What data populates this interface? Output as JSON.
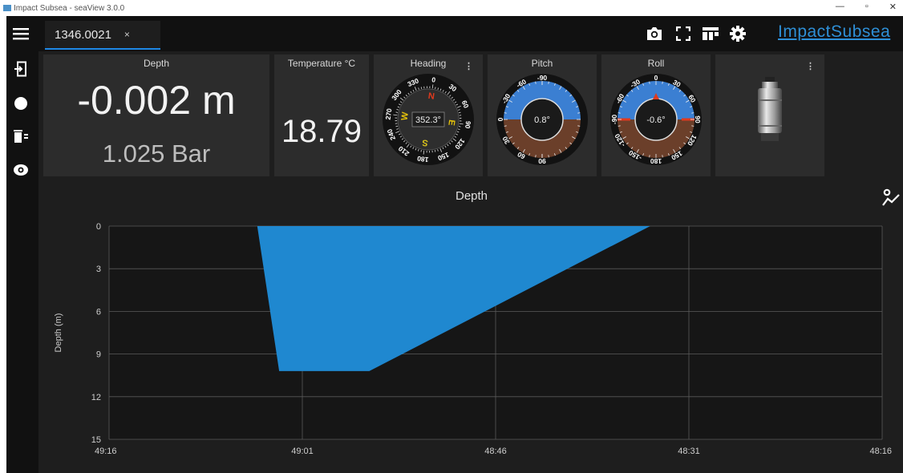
{
  "window": {
    "title": "Impact Subsea - seaView 3.0.0",
    "controls": [
      "—",
      "▫",
      "✕"
    ]
  },
  "sidebar": {
    "icons": [
      "hamburger-menu-icon",
      "connect-device-icon",
      "record-icon",
      "delete-icon",
      "view-icon"
    ]
  },
  "tab": {
    "label": "1346.0021",
    "close": "×"
  },
  "toolbar": {
    "icons": [
      "camera-icon",
      "fullscreen-icon",
      "layout-icon",
      "settings-icon"
    ],
    "brand": "ImpactSubsea"
  },
  "cards": {
    "depth": {
      "title": "Depth",
      "value": "-0.002 m",
      "pressure": "1.025 Bar"
    },
    "temperature": {
      "title": "Temperature °C",
      "value": "18.79"
    },
    "heading": {
      "title": "Heading",
      "menu": "⋮",
      "value": "352.3°",
      "heading_deg": 352.3,
      "tick_labels": [
        "0",
        "30",
        "60",
        "90",
        "120",
        "150",
        "180",
        "210",
        "240",
        "270",
        "300",
        "330"
      ],
      "cardinals": [
        "N",
        "E",
        "S",
        "W"
      ],
      "colors": {
        "N": "#e03a1e",
        "E": "#e6c20a",
        "S": "#d8c21a",
        "W": "#e6c20a"
      }
    },
    "pitch": {
      "title": "Pitch",
      "value": "0.8°",
      "pitch_deg": 0.8,
      "tick_labels": [
        "-90",
        "-60",
        "-30",
        "0",
        "30",
        "60",
        "90"
      ]
    },
    "roll": {
      "title": "Roll",
      "value": "-0.6°",
      "roll_deg": -0.6,
      "tick_labels": [
        "0",
        "30",
        "60",
        "90",
        "120",
        "150",
        "180",
        "-150",
        "-120",
        "-90",
        "-60",
        "-30"
      ]
    },
    "device": {
      "menu": "⋮"
    }
  },
  "colors": {
    "sky": "#3b7fd2",
    "ground": "#6b3f2a",
    "accent": "#1e88e5",
    "series": "#1f88d0"
  },
  "chart_data": {
    "type": "area",
    "title": "Depth",
    "ylabel": "Depth (m)",
    "xlabel": "",
    "y_inverted": true,
    "ylim": [
      0,
      15
    ],
    "yticks": [
      "0",
      "3",
      "6",
      "9",
      "12",
      "15"
    ],
    "x_reversed": true,
    "x_ticks": [
      "49:16",
      "49:01",
      "48:46",
      "48:31",
      "48:16"
    ],
    "grid": true,
    "series": [
      {
        "x": [
          "49:04.5",
          "49:02.8",
          "48:55.8",
          "48:34.0"
        ],
        "y": [
          0,
          10.2,
          10.2,
          0
        ]
      }
    ]
  }
}
